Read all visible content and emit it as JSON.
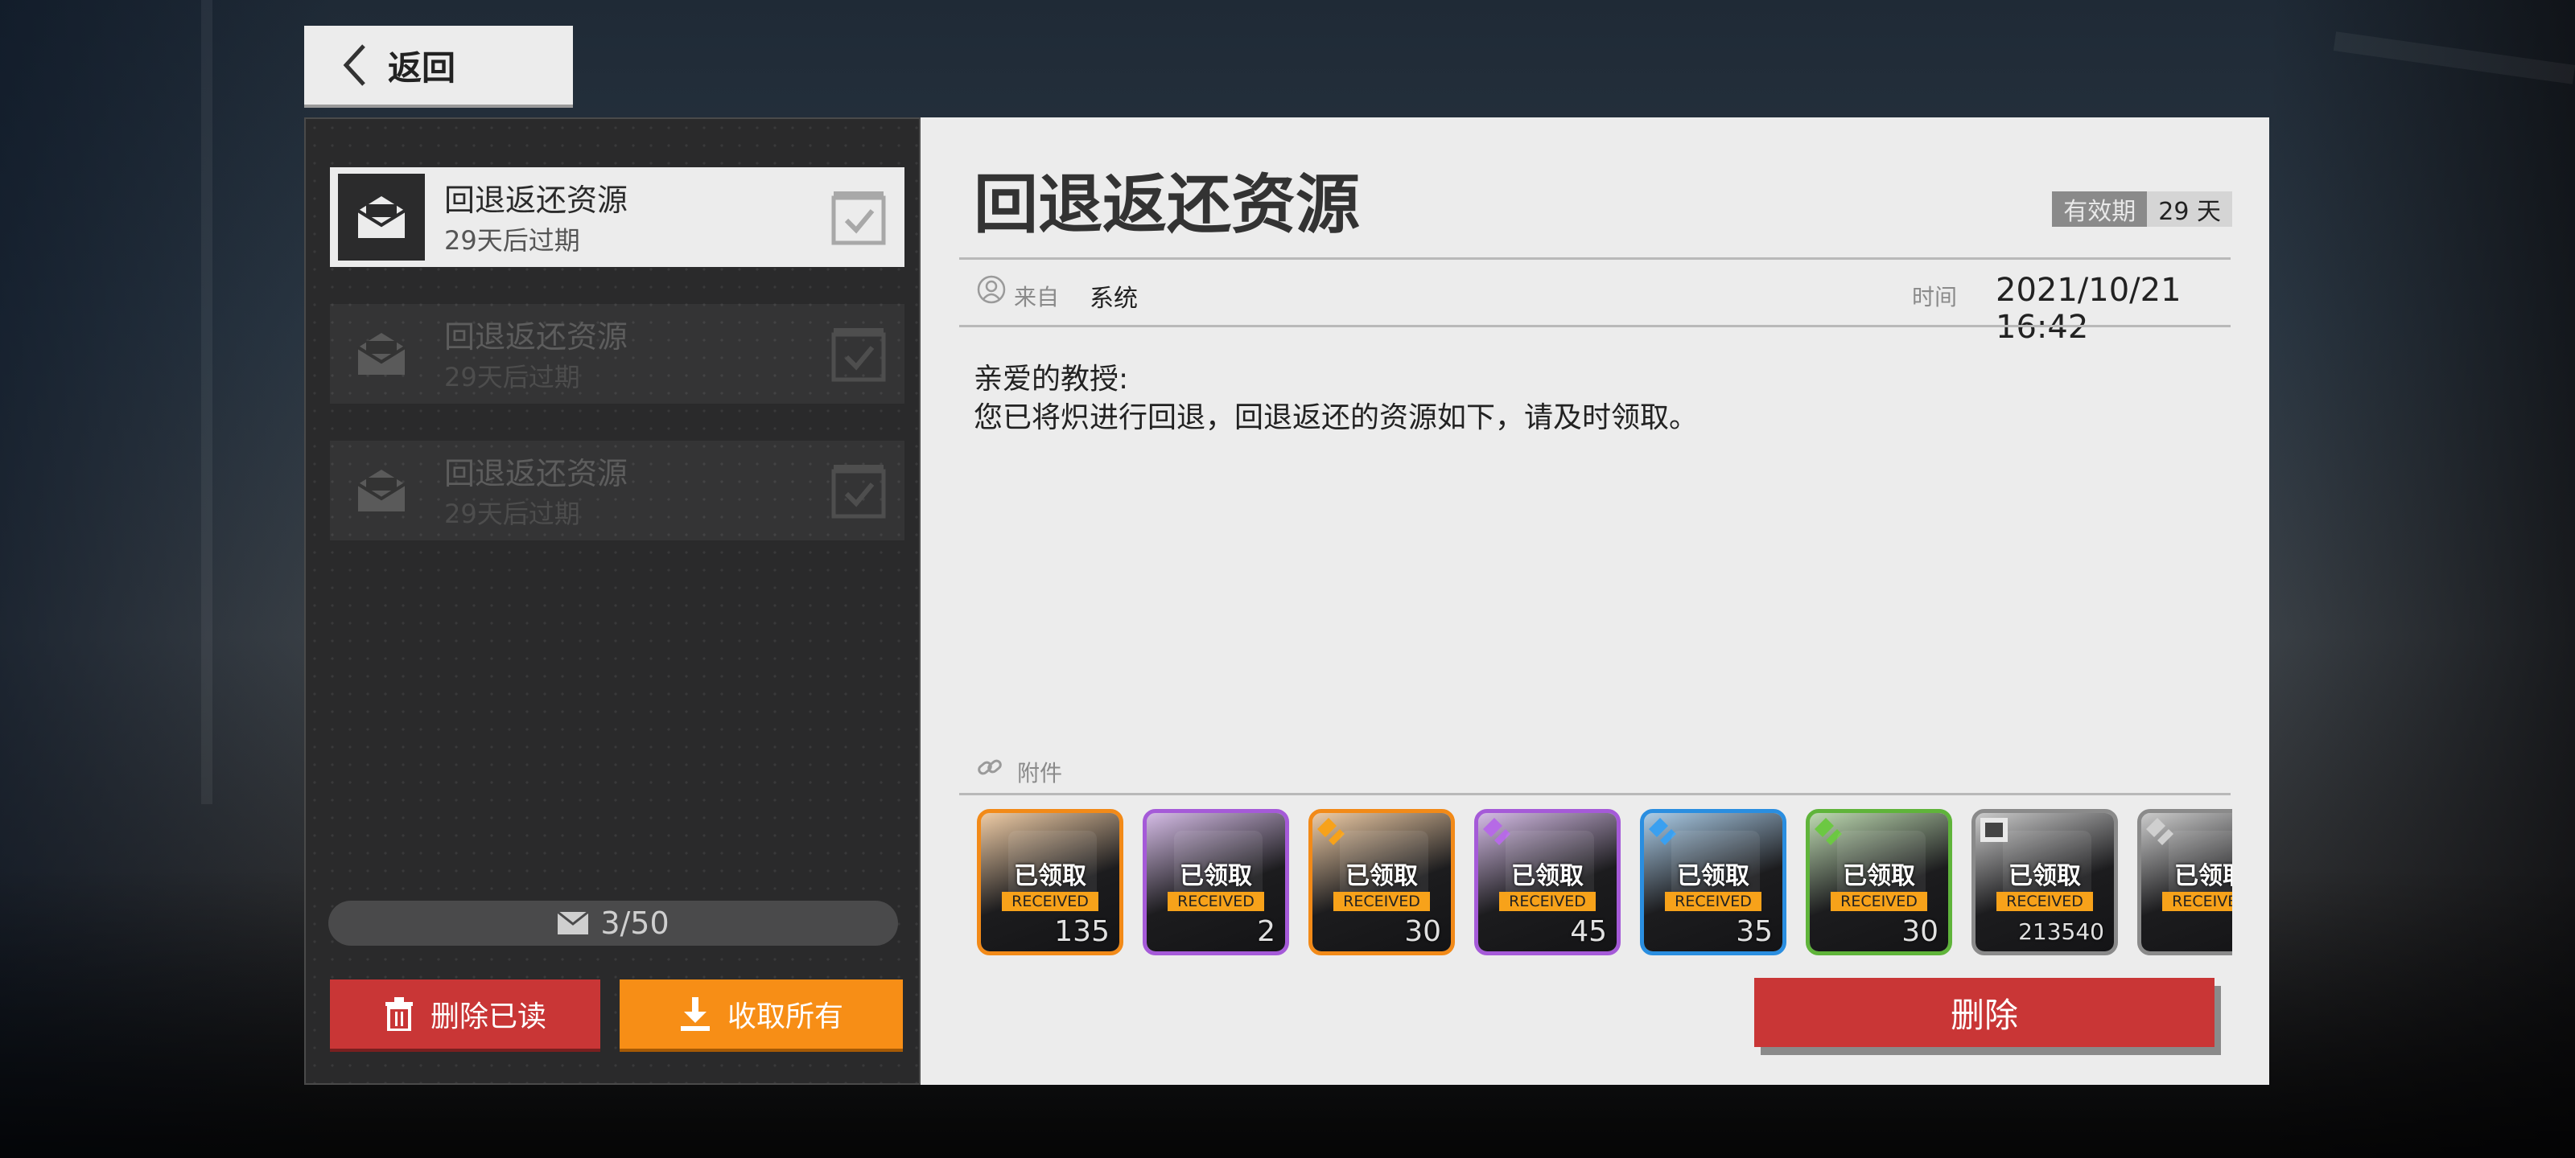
{
  "back_button": {
    "label": "返回"
  },
  "mail_list": [
    {
      "title": "回退返还资源",
      "subtitle": "29天后过期",
      "active": true
    },
    {
      "title": "回退返还资源",
      "subtitle": "29天后过期",
      "active": false
    },
    {
      "title": "回退返还资源",
      "subtitle": "29天后过期",
      "active": false
    }
  ],
  "mail_count": "3/50",
  "actions": {
    "delete_read": "删除已读",
    "collect_all": "收取所有"
  },
  "mail": {
    "title": "回退返还资源",
    "validity_label": "有效期",
    "validity_value": "29 天",
    "from_label": "来自",
    "from_value": "系统",
    "time_label": "时间",
    "time_value": "2021/10/21 16:42",
    "body": [
      "亲爱的教授:",
      "您已将炽进行回退，回退返还的资源如下，请及时领取。"
    ],
    "attachments_label": "附件",
    "delete_label": "删除"
  },
  "attachments": [
    {
      "status_cn": "已领取",
      "status_en": "RECEIVED",
      "qty": "135",
      "color": "#f28a18"
    },
    {
      "status_cn": "已领取",
      "status_en": "RECEIVED",
      "qty": "2",
      "color": "#a55ad8"
    },
    {
      "status_cn": "已领取",
      "status_en": "RECEIVED",
      "qty": "30",
      "color": "#f28a18"
    },
    {
      "status_cn": "已领取",
      "status_en": "RECEIVED",
      "qty": "45",
      "color": "#a55ad8"
    },
    {
      "status_cn": "已领取",
      "status_en": "RECEIVED",
      "qty": "35",
      "color": "#2a8ee0"
    },
    {
      "status_cn": "已领取",
      "status_en": "RECEIVED",
      "qty": "30",
      "color": "#5fb43a"
    },
    {
      "status_cn": "已领取",
      "status_en": "RECEIVED",
      "qty": "213540",
      "color": "#8a8a8a"
    },
    {
      "status_cn": "已领取",
      "status_en": "RECEIVED",
      "qty": "",
      "color": "#8a8a8a"
    }
  ],
  "colors": {
    "accent_orange": "#f78e16",
    "accent_red": "#c93636"
  }
}
